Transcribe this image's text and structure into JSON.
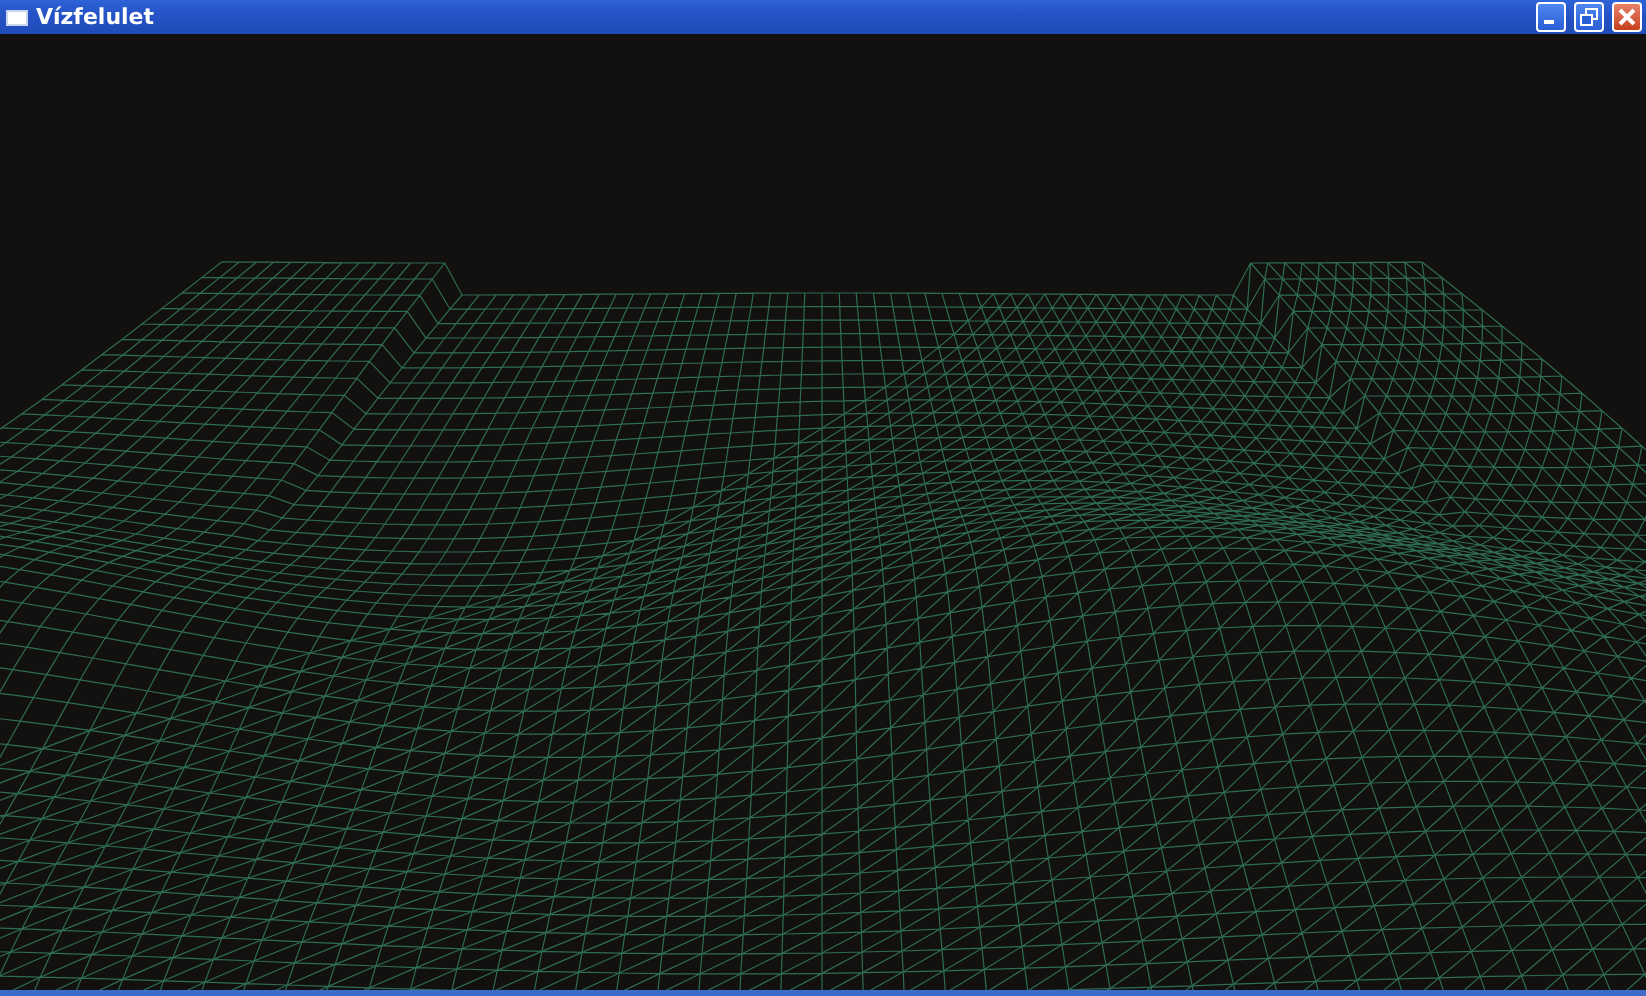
{
  "window": {
    "title": "Vízfelulet"
  }
}
